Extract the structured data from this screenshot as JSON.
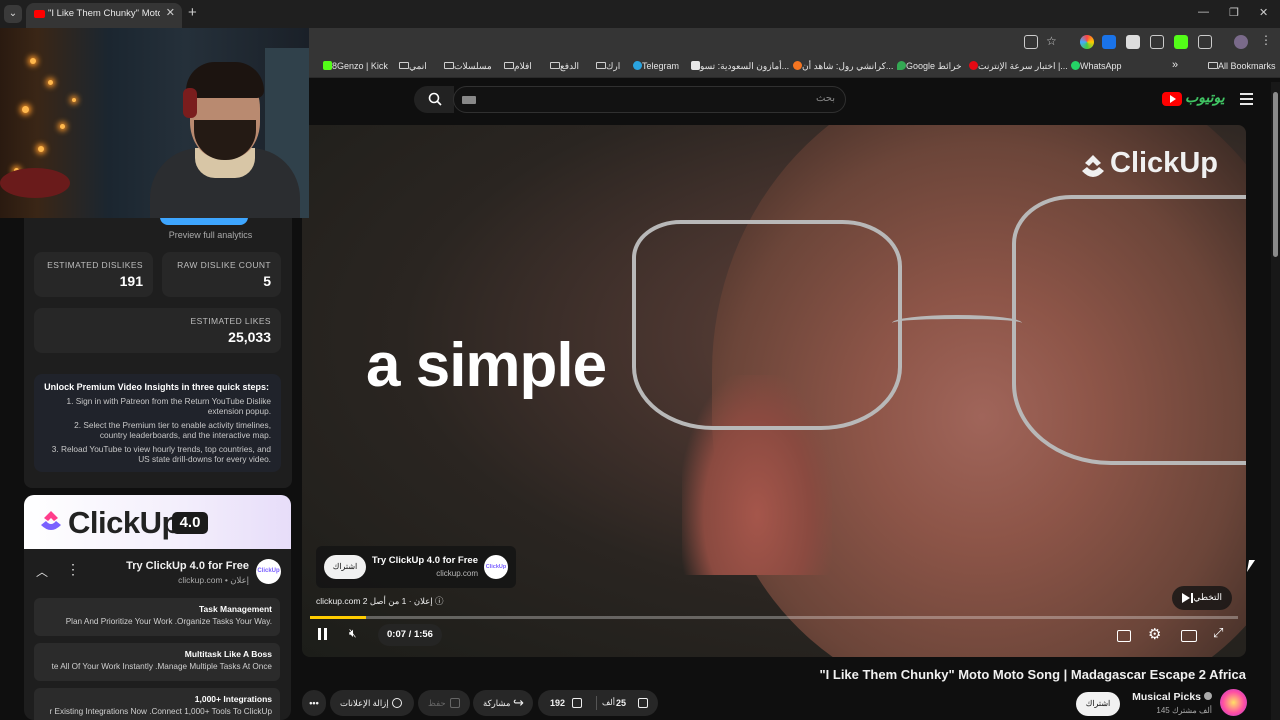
{
  "browser": {
    "tab_title": "\"I Like Them Chunky\" Moto Mo",
    "bookmarks": [
      {
        "label": "8Genzo | Kick",
        "color": "#53fc18"
      },
      {
        "label": "انمي"
      },
      {
        "label": "مسلسلات"
      },
      {
        "label": "افلام"
      },
      {
        "label": "الدفع"
      },
      {
        "label": "ارك"
      },
      {
        "label": "Telegram",
        "color": "#2aa3df"
      },
      {
        "label": "أمازون السعودية: تسو...",
        "color": "#e8e8e8"
      },
      {
        "label": "كرانشي رول: شاهد أن...",
        "color": "#f47521"
      },
      {
        "label": "Google خرائط",
        "color": "#34a853"
      },
      {
        "label": "اختبار سرعة الإنترنت |...",
        "color": "#e50914"
      },
      {
        "label": "WhatsApp",
        "color": "#25d366"
      }
    ],
    "all_bookmarks": "All Bookmarks"
  },
  "sidebar": {
    "preview_analytics": "Preview full analytics",
    "stats": {
      "estimated_dislikes_label": "ESTIMATED DISLIKES",
      "estimated_dislikes": "191",
      "raw_dislike_label": "RAW DISLIKE COUNT",
      "raw_dislike": "5",
      "estimated_likes_label": "ESTIMATED LIKES",
      "estimated_likes": "25,033"
    },
    "premium": {
      "heading": "Unlock Premium Video Insights in three quick steps:",
      "step1": "1. Sign in with Patreon from the Return YouTube Dislike extension popup.",
      "step2": "2. Select the Premium tier to enable activity timelines, country leaderboards, and the interactive map.",
      "step3": "3. Reload YouTube to view hourly trends, top countries, and US state drill-downs for every video."
    },
    "ad": {
      "brand": "ClickUp",
      "version": "4.0",
      "title": "Try ClickUp 4.0 for Free",
      "domain": "clickup.com • إعلان",
      "logo_text": "ClickUp",
      "features": [
        {
          "title": "Task Management",
          "desc": "Plan And Prioritize Your Work .Organize Tasks Your Way."
        },
        {
          "title": "Multitask Like A Boss",
          "desc": "te All Of Your Work Instantly .Manage Multiple Tasks At Once"
        },
        {
          "title": "1,000+ Integrations",
          "desc": "r Existing Integrations Now .Connect 1,000+ Tools To ClickUp"
        }
      ]
    }
  },
  "youtube": {
    "search_placeholder": "بحث",
    "logo_text": "يوتيوب"
  },
  "player": {
    "overlay_text": "a simple",
    "watermark": "ClickUp",
    "ad_card": {
      "button": "اشتراك",
      "title": "Try ClickUp 4.0 for Free",
      "domain": "clickup.com",
      "logo_text": "ClickUp"
    },
    "ad_info": "clickup.com   إعلان · 1 من أصل 2 ⓘ",
    "skip_label": "التخطي",
    "time": "0:07 / 1:56",
    "progress": 0.06
  },
  "video": {
    "title": "\"I Like Them Chunky\" Moto Moto Song | Madagascar Escape 2 Africa",
    "channel": "Musical Picks",
    "subscribers": "145 ألف مشترك",
    "subscribe_label": "اشتراك",
    "likes": "25",
    "likes_unit": "ألف",
    "dislikes": "192",
    "share_label": "مشاركة",
    "save_label": "حفظ",
    "remove_ads_label": "إزالة الإعلانات",
    "more_label": "•••"
  }
}
